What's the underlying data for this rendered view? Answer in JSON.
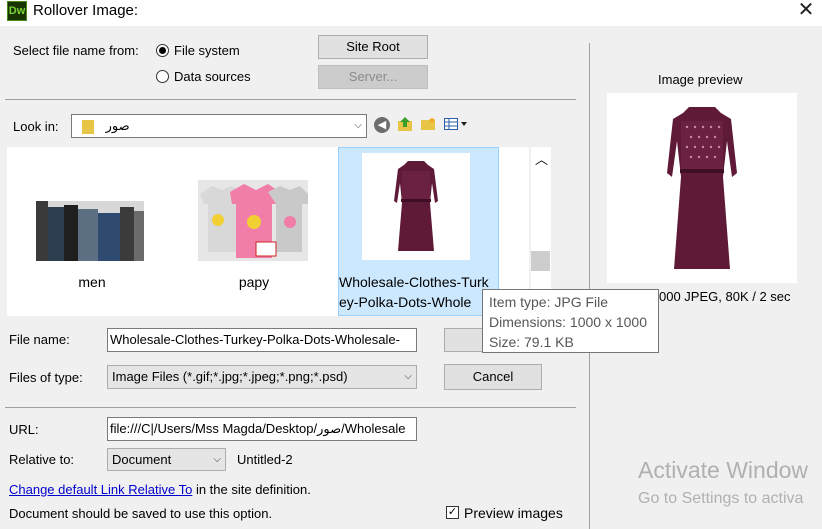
{
  "window": {
    "title": "Rollover Image:",
    "app_logo": "Dw"
  },
  "select_from": {
    "label": "Select file name from:",
    "options": [
      "File system",
      "Data sources"
    ],
    "selected": "File system"
  },
  "buttons": {
    "site_root": "Site Root",
    "server": "Server...",
    "cancel": "Cancel",
    "ok": ""
  },
  "look_in": {
    "label": "Look in:",
    "value": "صور"
  },
  "files": [
    {
      "name": "men",
      "image": "rack of menswear"
    },
    {
      "name": "papy",
      "image": "kids t-shirts"
    },
    {
      "name": "Wholesale-Clothes-Turkey-Polka-Dots-Wholesale",
      "display_line1": "Wholesale-Clothes-Turk",
      "display_line2": "ey-Polka-Dots-Whole",
      "image": "purple polka dot dress",
      "selected": true
    }
  ],
  "tooltip": {
    "item_type": "Item type: JPG File",
    "dimensions": "Dimensions: 1000 x 1000",
    "size": "Size: 79.1 KB"
  },
  "file_name": {
    "label": "File name:",
    "value": "Wholesale-Clothes-Turkey-Polka-Dots-Wholesale-"
  },
  "files_of_type": {
    "label": "Files of type:",
    "value": "Image Files (*.gif;*.jpg;*.jpeg;*.png;*.psd)"
  },
  "url": {
    "label": "URL:",
    "value": "file:///C|/Users/Mss Magda/Desktop/صور/Wholesale"
  },
  "relative_to": {
    "label": "Relative to:",
    "value": "Document",
    "doc_name": "Untitled-2"
  },
  "link_text": {
    "link": "Change default Link Relative To",
    "suffix": " in the site definition."
  },
  "status_note": "Document should be saved to use this option.",
  "preview": {
    "heading": "Image preview",
    "info": "000 JPEG, 80K / 2 sec",
    "checkbox_label": "Preview images",
    "checked": true
  },
  "watermark": {
    "line1": "Activate Window",
    "line2": "Go to Settings to activa"
  },
  "colors": {
    "dress": "#5e1a36",
    "selection": "#cce8ff",
    "link": "#0000cc"
  }
}
